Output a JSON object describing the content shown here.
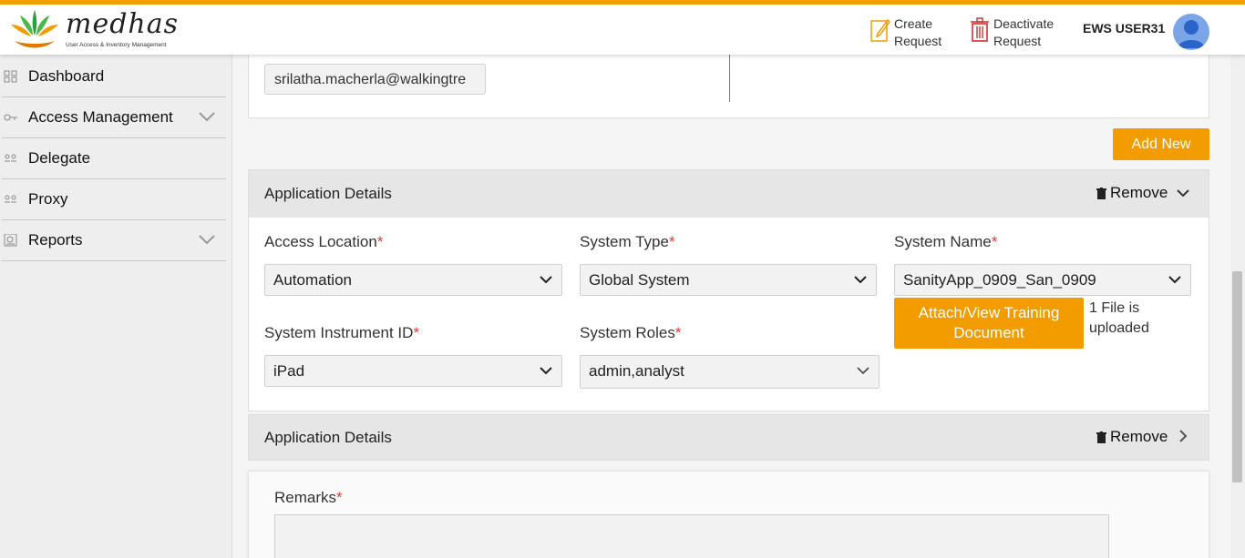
{
  "brand": {
    "name": "medhas",
    "tagline": "User Access & Inventory Management",
    "accent": "#f39c00"
  },
  "header": {
    "create_request": "Create Request",
    "deactivate_request": "Deactivate Request",
    "user_name": "EWS USER31"
  },
  "sidebar": {
    "items": [
      {
        "label": "Dashboard",
        "icon": "grid-icon"
      },
      {
        "label": "Access Management",
        "icon": "key-icon",
        "expandable": true
      },
      {
        "label": "Delegate",
        "icon": "people-icon"
      },
      {
        "label": "Proxy",
        "icon": "people-icon"
      },
      {
        "label": "Reports",
        "icon": "report-icon",
        "expandable": true
      }
    ]
  },
  "top_card": {
    "email_value": "srilatha.macherla@walkingtre"
  },
  "add_new_label": "Add New",
  "app_panel_1": {
    "title": "Application Details",
    "remove_label": "Remove",
    "access_location": {
      "label": "Access Location",
      "value": "Automation"
    },
    "system_type": {
      "label": "System Type",
      "value": "Global System"
    },
    "system_name": {
      "label": "System Name",
      "value": "SanityApp_0909_San_0909"
    },
    "system_instrument_id": {
      "label": "System Instrument ID",
      "value": "iPad"
    },
    "system_roles": {
      "label": "System Roles",
      "value": "admin,analyst"
    },
    "attach_label": "Attach/View Training Document",
    "file_note": "1 File is uploaded",
    "required_mark": "*"
  },
  "app_panel_2": {
    "title": "Application Details",
    "remove_label": "Remove"
  },
  "remarks": {
    "label": "Remarks",
    "required_mark": "*"
  }
}
